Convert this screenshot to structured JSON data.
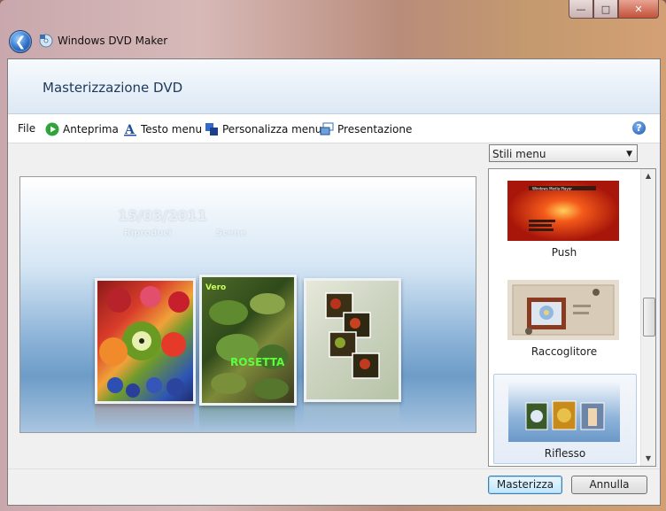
{
  "window": {
    "app_title": "Windows DVD Maker",
    "controls": {
      "minimize": "—",
      "maximize": "□",
      "close": "✕"
    }
  },
  "header": {
    "page_title": "Masterizzazione DVD"
  },
  "toolbar": {
    "file": "File",
    "preview": "Anteprima",
    "menu_text": "Testo menu",
    "customize_menu": "Personalizza menu",
    "slideshow": "Presentazione",
    "help_icon": "?"
  },
  "preview": {
    "date": "15/03/2011",
    "play_label": "Riproduci",
    "scenes_label": "Scene",
    "card_caption": "ROSETTA",
    "card_caption_top": "Vero"
  },
  "styles_panel": {
    "dropdown_selected": "Stili menu",
    "items": [
      {
        "label": "Push",
        "thumb_caption": "Windows Media Player"
      },
      {
        "label": "Raccoglitore"
      },
      {
        "label": "Riflesso"
      }
    ]
  },
  "buttons": {
    "burn": "Masterizza",
    "cancel": "Annulla"
  },
  "colors": {
    "header_title": "#1e395b",
    "accent": "#3c7fb1"
  }
}
